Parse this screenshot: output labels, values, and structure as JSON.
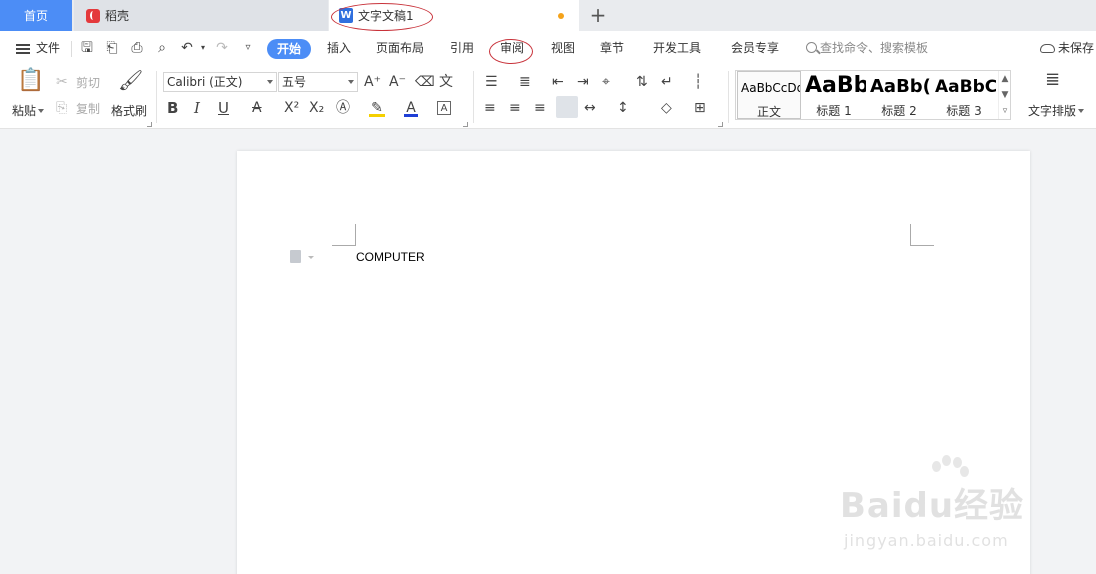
{
  "tabs": {
    "home": "首页",
    "daoke": "稻壳",
    "doc_title": "文字文稿1",
    "doc_icon_letter": "W"
  },
  "menu": {
    "file": "文件",
    "tabs": [
      "开始",
      "插入",
      "页面布局",
      "引用",
      "审阅",
      "视图",
      "章节",
      "开发工具",
      "会员专享"
    ],
    "search_placeholder": "查找命令、搜索模板",
    "unsaved": "未保存"
  },
  "ribbon": {
    "paste": "粘贴",
    "cut": "剪切",
    "copy": "复制",
    "format_painter": "格式刷",
    "font_name": "Calibri (正文)",
    "font_size": "五号",
    "styles": [
      {
        "sample": "AaBbCcDd",
        "name": "正文"
      },
      {
        "sample": "AaBb",
        "name": "标题 1"
      },
      {
        "sample": "AaBb(",
        "name": "标题 2"
      },
      {
        "sample": "AaBbC",
        "name": "标题 3"
      }
    ],
    "text_layout": "文字排版"
  },
  "document": {
    "text": "COMPUTER"
  },
  "watermark": {
    "brand": "Baidu经验",
    "url": "jingyan.baidu.com"
  },
  "colors": {
    "accent": "#4c8df6",
    "highlight_oval": "#c8323a",
    "unsaved_dot": "#f4a21a"
  }
}
